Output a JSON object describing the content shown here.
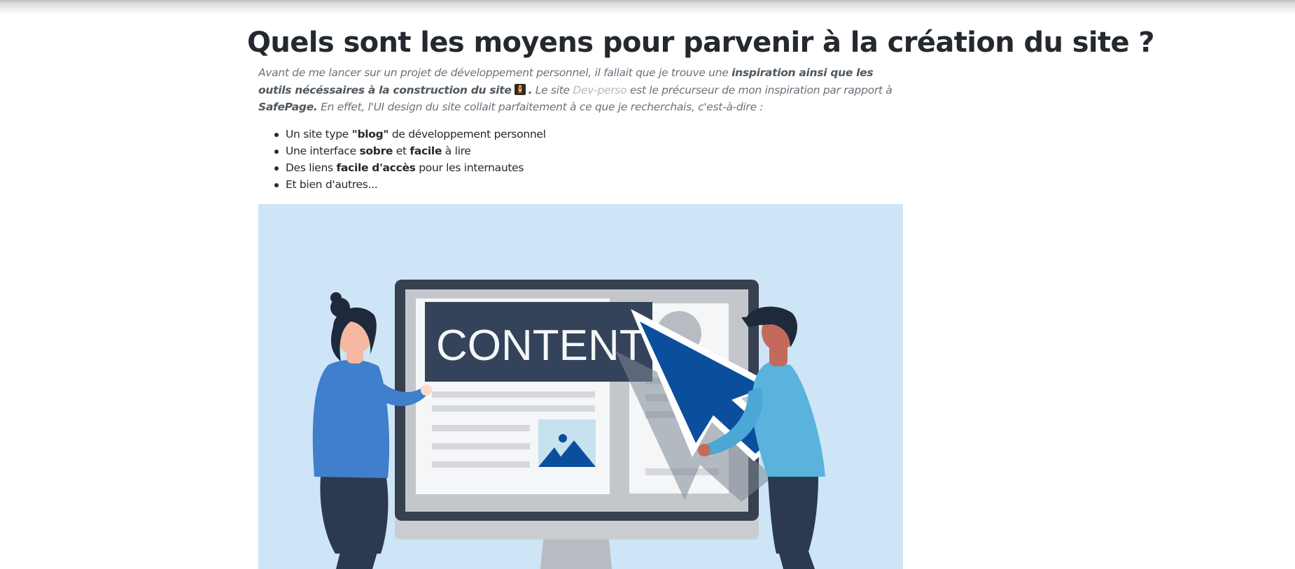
{
  "article": {
    "title": "Quels sont les moyens pour parvenir à la création du site ?",
    "intro": {
      "t1": "Avant de me lancer sur un projet de développement personnel, il fallait que je trouve une ",
      "b1": "inspiration ainsi que les outils nécéssaires à la construction du site",
      "emoji": "rocket-emoji-icon",
      "b2": ".",
      "t2": " Le site ",
      "link": "Dev-perso",
      "t3": " est le précurseur de mon inspiration par rapport à ",
      "b3": "SafePage.",
      "t4": " En effet, l'UI design du site collait parfaitement à ce que je recherchais, c'est-à-dire :"
    },
    "features": [
      {
        "pre": "Un site type ",
        "bold": "\"blog\"",
        "post": " de développement personnel"
      },
      {
        "pre": "Une interface ",
        "bold": "sobre",
        "mid": " et ",
        "bold2": "facile",
        "post": " à lire"
      },
      {
        "pre": "Des liens ",
        "bold": "facile d'accès",
        "post": " pour les internautes"
      },
      {
        "pre": "Et bien d'autres..."
      }
    ]
  },
  "illustration": {
    "screen_text": "CONTENT",
    "icons": [
      "monitor-icon",
      "cursor-arrow-icon",
      "image-placeholder-icon",
      "avatar-placeholder-icon",
      "person-left-figure",
      "person-right-figure"
    ],
    "colors": {
      "background": "#cde5f6",
      "monitor_frame": "#36404f",
      "banner": "#34435a",
      "cursor": "#0b4f9c",
      "person_left_shirt": "#3f7fcc",
      "person_right_shirt": "#59b3dd"
    }
  }
}
